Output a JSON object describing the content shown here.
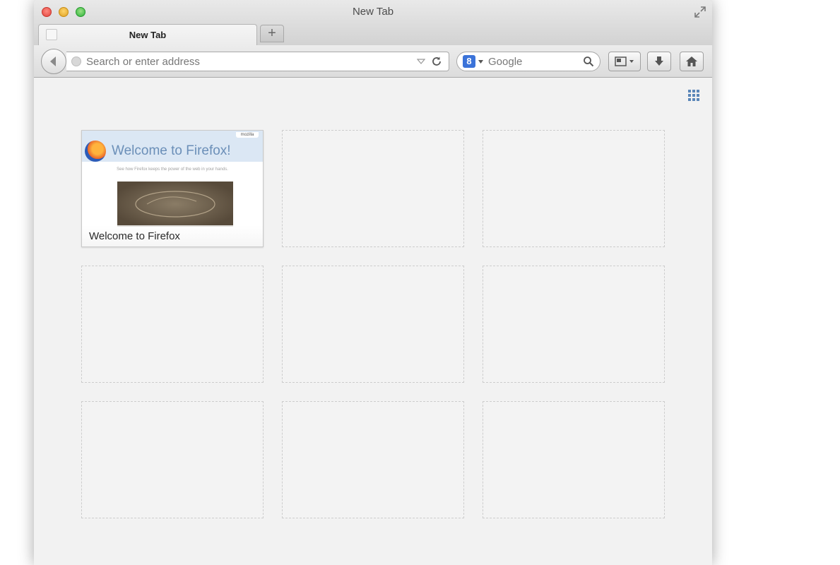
{
  "window": {
    "title": "New Tab"
  },
  "tabs": [
    {
      "label": "New Tab"
    }
  ],
  "newtab": {
    "label": "+"
  },
  "urlbar": {
    "placeholder": "Search or enter address"
  },
  "searchbar": {
    "engine_icon": "8",
    "placeholder": "Google"
  },
  "icons": {
    "fullscreen": "fullscreen-icon",
    "back": "back-arrow-icon",
    "reload": "reload-icon",
    "search": "magnifier-icon",
    "bookmarks": "bookmarks-icon",
    "download": "download-arrow-icon",
    "home": "home-icon",
    "grid": "grid-toggle-icon"
  },
  "colors": {
    "close": "#e0443e",
    "minimize": "#dea123",
    "maximize": "#2fb13b",
    "search_engine": "#3b73d9",
    "grid_icon": "#5a86b8"
  },
  "tiles": [
    {
      "title": "Welcome to Firefox",
      "thumbnail": {
        "heading": "Welcome to Firefox!",
        "badge": "mozilla",
        "subline": "See how Firefox keeps the power of the web in your hands."
      }
    },
    {
      "title": ""
    },
    {
      "title": ""
    },
    {
      "title": ""
    },
    {
      "title": ""
    },
    {
      "title": ""
    },
    {
      "title": ""
    },
    {
      "title": ""
    },
    {
      "title": ""
    }
  ]
}
